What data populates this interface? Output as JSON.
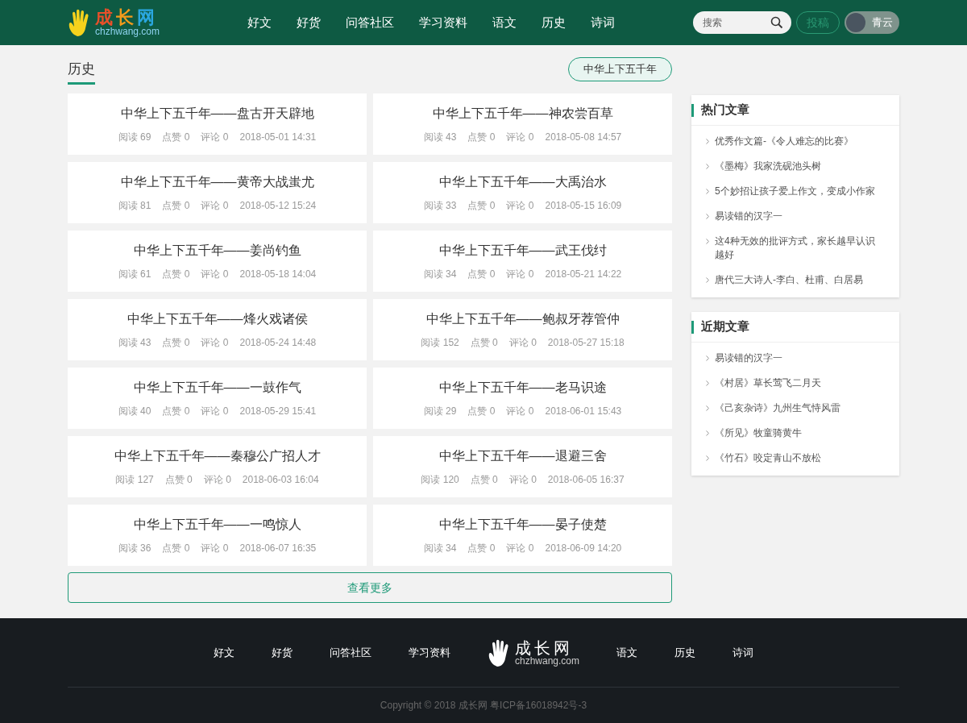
{
  "header": {
    "logo": {
      "title": "成长网",
      "domain": "chzhwang.com"
    },
    "nav": [
      "好文",
      "好货",
      "问答社区",
      "学习资料",
      "语文",
      "历史",
      "诗词"
    ],
    "search": {
      "placeholder": "搜索"
    },
    "submit_button": "投稿",
    "user": {
      "name": "青云"
    }
  },
  "section": {
    "title": "历史",
    "tag": "中华上下五千年"
  },
  "articles": [
    {
      "title": "中华上下五千年——盘古开天辟地",
      "reads": "阅读 69",
      "likes": "点赞 0",
      "comments": "评论 0",
      "date": "2018-05-01 14:31"
    },
    {
      "title": "中华上下五千年——神农尝百草",
      "reads": "阅读 43",
      "likes": "点赞 0",
      "comments": "评论 0",
      "date": "2018-05-08 14:57"
    },
    {
      "title": "中华上下五千年——黄帝大战蚩尤",
      "reads": "阅读 81",
      "likes": "点赞 0",
      "comments": "评论 0",
      "date": "2018-05-12 15:24"
    },
    {
      "title": "中华上下五千年——大禹治水",
      "reads": "阅读 33",
      "likes": "点赞 0",
      "comments": "评论 0",
      "date": "2018-05-15 16:09"
    },
    {
      "title": "中华上下五千年——姜尚钓鱼",
      "reads": "阅读 61",
      "likes": "点赞 0",
      "comments": "评论 0",
      "date": "2018-05-18 14:04"
    },
    {
      "title": "中华上下五千年——武王伐纣",
      "reads": "阅读 34",
      "likes": "点赞 0",
      "comments": "评论 0",
      "date": "2018-05-21 14:22"
    },
    {
      "title": "中华上下五千年——烽火戏诸侯",
      "reads": "阅读 43",
      "likes": "点赞 0",
      "comments": "评论 0",
      "date": "2018-05-24 14:48"
    },
    {
      "title": "中华上下五千年——鲍叔牙荐管仲",
      "reads": "阅读 152",
      "likes": "点赞 0",
      "comments": "评论 0",
      "date": "2018-05-27 15:18"
    },
    {
      "title": "中华上下五千年——一鼓作气",
      "reads": "阅读 40",
      "likes": "点赞 0",
      "comments": "评论 0",
      "date": "2018-05-29 15:41"
    },
    {
      "title": "中华上下五千年——老马识途",
      "reads": "阅读 29",
      "likes": "点赞 0",
      "comments": "评论 0",
      "date": "2018-06-01 15:43"
    },
    {
      "title": "中华上下五千年——秦穆公广招人才",
      "reads": "阅读 127",
      "likes": "点赞 0",
      "comments": "评论 0",
      "date": "2018-06-03 16:04"
    },
    {
      "title": "中华上下五千年——退避三舍",
      "reads": "阅读 120",
      "likes": "点赞 0",
      "comments": "评论 0",
      "date": "2018-06-05 16:37"
    },
    {
      "title": "中华上下五千年——一鸣惊人",
      "reads": "阅读 36",
      "likes": "点赞 0",
      "comments": "评论 0",
      "date": "2018-06-07 16:35"
    },
    {
      "title": "中华上下五千年——晏子使楚",
      "reads": "阅读 34",
      "likes": "点赞 0",
      "comments": "评论 0",
      "date": "2018-06-09 14:20"
    }
  ],
  "more_button": "查看更多",
  "sidebar": [
    {
      "title": "热门文章",
      "items": [
        "优秀作文篇-《令人难忘的比赛》",
        "《墨梅》我家洗砚池头树",
        "5个妙招让孩子爱上作文，变成小作家",
        "易读错的汉字一",
        "这4种无效的批评方式，家长越早认识越好",
        "唐代三大诗人-李白、杜甫、白居易"
      ]
    },
    {
      "title": "近期文章",
      "items": [
        "易读错的汉字一",
        "《村居》草长莺飞二月天",
        "《己亥杂诗》九州生气恃风雷",
        "《所见》牧童骑黄牛",
        "《竹石》咬定青山不放松"
      ]
    }
  ],
  "footer": {
    "nav_left": [
      "好文",
      "好货",
      "问答社区",
      "学习资料"
    ],
    "logo": {
      "title": "成长网",
      "domain": "chzhwang.com"
    },
    "nav_right": [
      "语文",
      "历史",
      "诗词"
    ],
    "copyright": "Copyright © 2018 成长网 粤ICP备16018942号-3"
  }
}
